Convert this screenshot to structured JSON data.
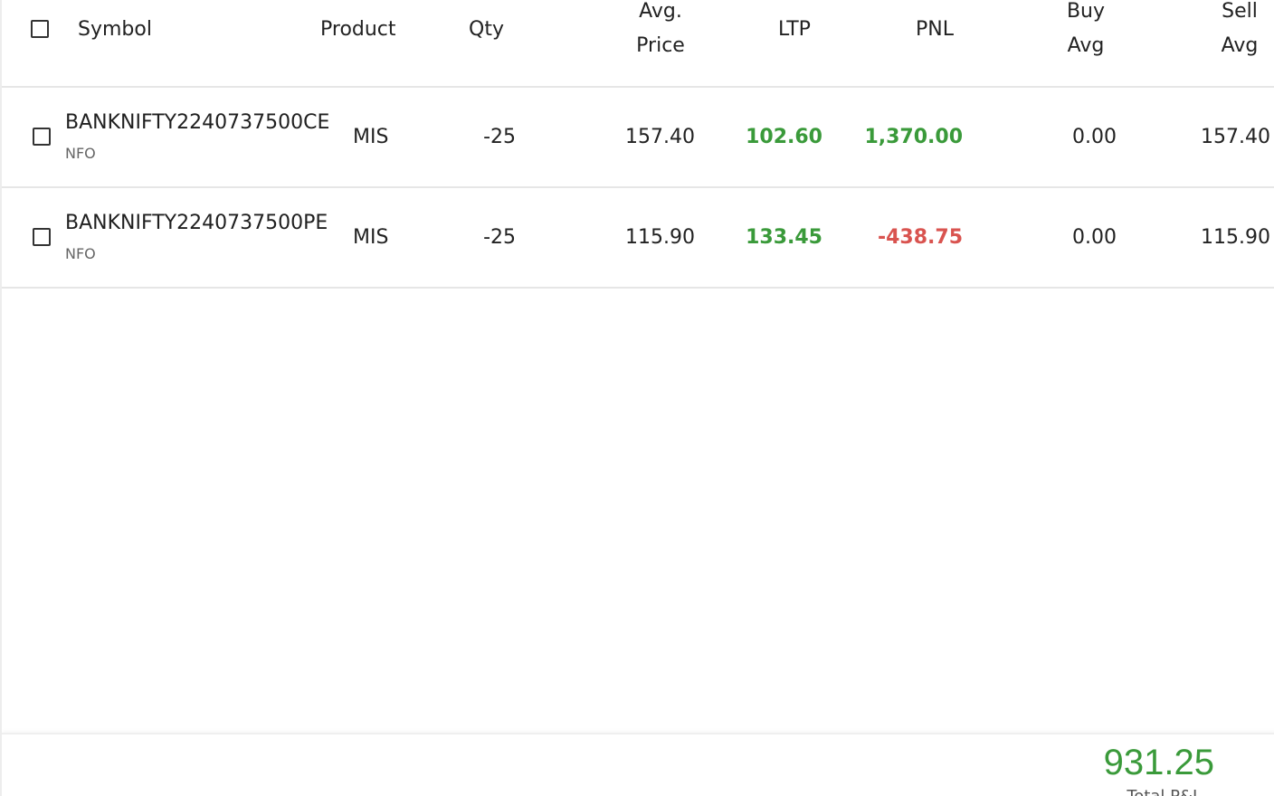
{
  "header": {
    "symbol": "Symbol",
    "product": "Product",
    "qty": "Qty",
    "avg_price_line1": "Avg.",
    "avg_price_line2": "Price",
    "ltp": "LTP",
    "pnl": "PNL",
    "buy_avg_line1": "Buy",
    "buy_avg_line2": "Avg",
    "sell_avg_line1": "Sell",
    "sell_avg_line2": "Avg"
  },
  "rows": [
    {
      "symbol": "BANKNIFTY2240737500CE",
      "exchange": "NFO",
      "product": "MIS",
      "qty": "-25",
      "avg_price": "157.40",
      "ltp": "102.60",
      "pnl": "1,370.00",
      "buy_avg": "0.00",
      "sell_avg": "157.40"
    },
    {
      "symbol": "BANKNIFTY2240737500PE",
      "exchange": "NFO",
      "product": "MIS",
      "qty": "-25",
      "avg_price": "115.90",
      "ltp": "133.45",
      "pnl": "-438.75",
      "buy_avg": "0.00",
      "sell_avg": "115.90"
    }
  ],
  "footer": {
    "total_value": "931.25",
    "total_label": "Total P&L"
  },
  "colors": {
    "profit": "#3a9a3a",
    "loss": "#d9534f"
  }
}
